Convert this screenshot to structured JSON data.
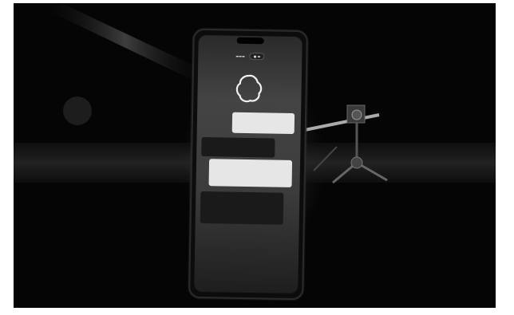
{
  "scene": {
    "description_visible": "",
    "phone": {
      "status_time": "",
      "status_icons": "",
      "app_title": "",
      "mode_chip": "",
      "orb_icon": "voice-orb-icon",
      "messages": [
        {
          "role": "user",
          "text": ""
        },
        {
          "role": "assistant",
          "text": ""
        },
        {
          "role": "user",
          "text": ""
        },
        {
          "role": "assistant",
          "text": ""
        }
      ]
    }
  }
}
